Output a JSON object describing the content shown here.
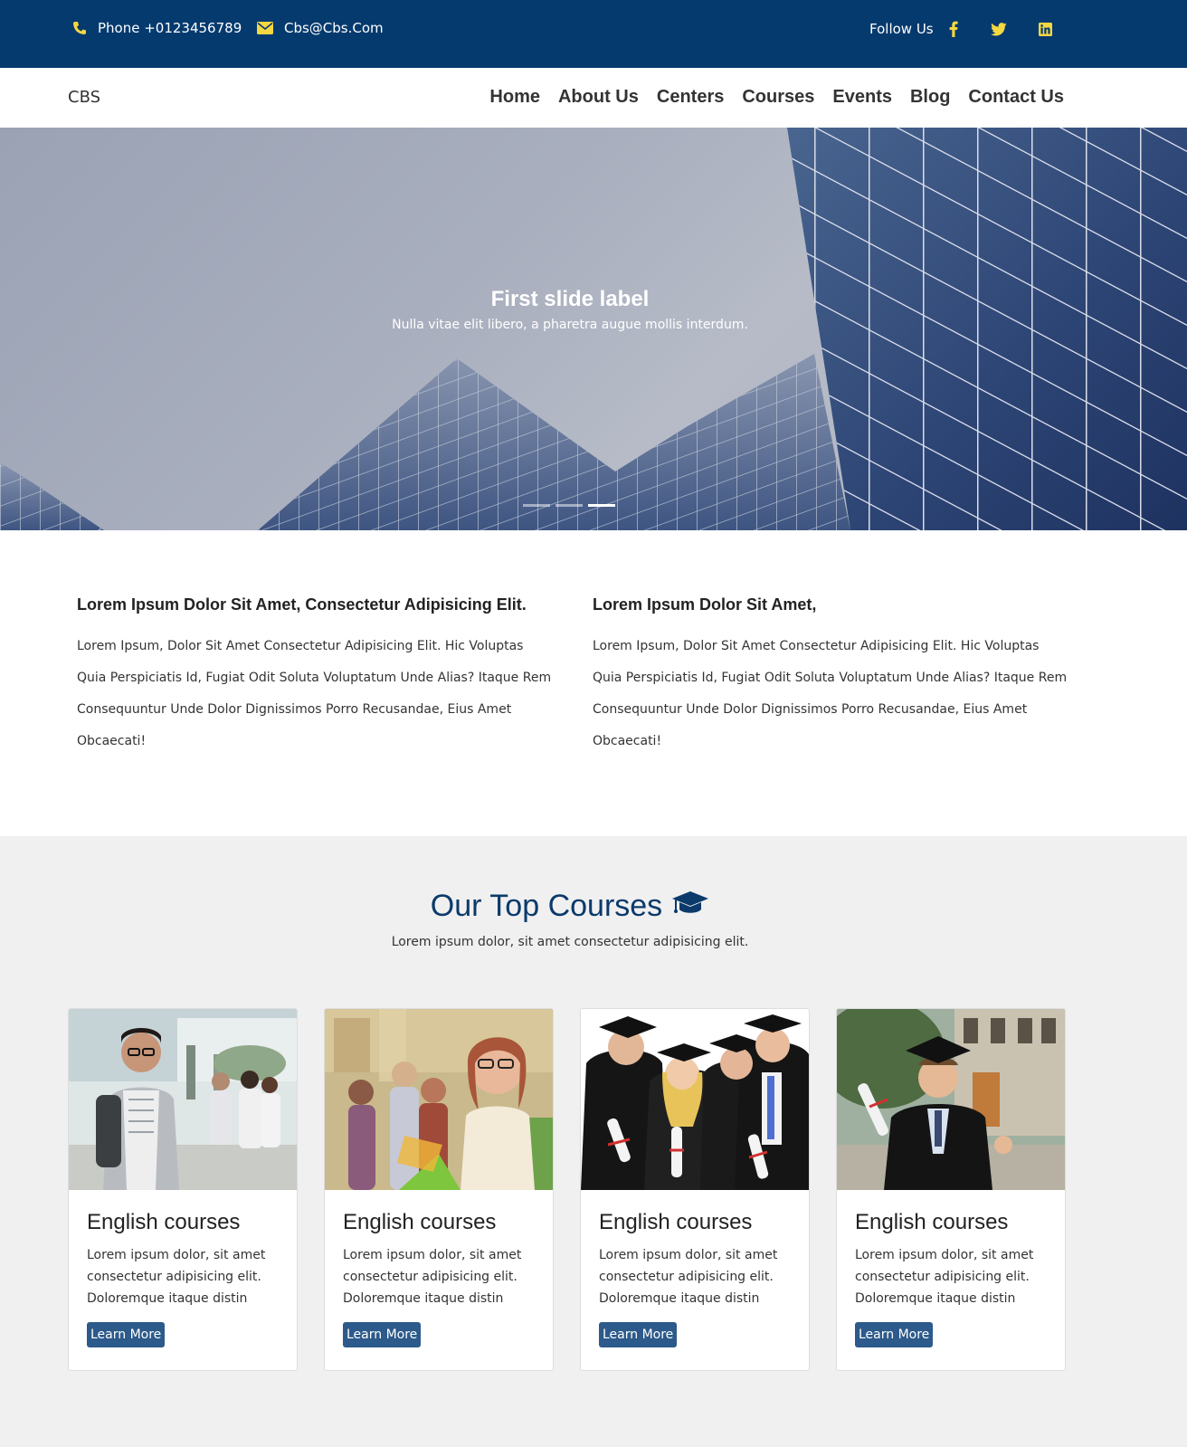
{
  "topbar": {
    "phone": "Phone +0123456789",
    "email": "Cbs@Cbs.Com",
    "follow": "Follow Us",
    "icons": [
      "phone-icon",
      "envelope-icon",
      "facebook-icon",
      "twitter-icon",
      "linkedin-icon"
    ],
    "icon_color": "#f5d742",
    "background": "#053a6e"
  },
  "navbar": {
    "brand": "CBS",
    "items": [
      "Home",
      "About Us",
      "Centers",
      "Courses",
      "Events",
      "Blog",
      "Contact Us"
    ]
  },
  "hero": {
    "title": "First slide label",
    "subtitle": "Nulla vitae elit libero, a pharetra augue mollis interdum.",
    "slides": 3,
    "active_slide": 3
  },
  "intro": [
    {
      "heading": "Lorem Ipsum Dolor Sit Amet, Consectetur Adipisicing Elit.",
      "text": "Lorem Ipsum, Dolor Sit Amet Consectetur Adipisicing Elit. Hic Voluptas Quia Perspiciatis Id, Fugiat Odit Soluta Voluptatum Unde Alias? Itaque Rem Consequuntur Unde Dolor Dignissimos Porro Recusandae, Eius Amet Obcaecati!"
    },
    {
      "heading": "Lorem Ipsum Dolor Sit Amet,",
      "text": "Lorem Ipsum, Dolor Sit Amet Consectetur Adipisicing Elit. Hic Voluptas Quia Perspiciatis Id, Fugiat Odit Soluta Voluptatum Unde Alias? Itaque Rem Consequuntur Unde Dolor Dignissimos Porro Recusandae, Eius Amet Obcaecati!"
    }
  ],
  "courses": {
    "title": "Our Top Courses",
    "title_icon": "graduation-cap-icon",
    "subtitle": "Lorem ipsum dolor, sit amet consectetur adipisicing elit.",
    "accent": "#0b3a6b",
    "cards": [
      {
        "title": "English courses",
        "text": "Lorem ipsum dolor, sit amet consectetur adipisicing elit. Doloremque itaque distin",
        "button": "Learn More"
      },
      {
        "title": "English courses",
        "text": "Lorem ipsum dolor, sit amet consectetur adipisicing elit. Doloremque itaque distin",
        "button": "Learn More"
      },
      {
        "title": "English courses",
        "text": "Lorem ipsum dolor, sit amet consectetur adipisicing elit. Doloremque itaque distin",
        "button": "Learn More"
      },
      {
        "title": "English courses",
        "text": "Lorem ipsum dolor, sit amet consectetur adipisicing elit. Doloremque itaque distin",
        "button": "Learn More"
      }
    ]
  }
}
